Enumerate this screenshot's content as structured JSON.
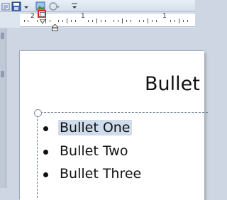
{
  "toolbar": {
    "icons": [
      "text-direction-icon",
      "save-icon",
      "picture-icon",
      "circle-icon",
      "dropdown-icon"
    ]
  },
  "ruler": {
    "numbers": [
      "2",
      "1",
      "1"
    ],
    "tab_selector": "left-tab-stop-icon"
  },
  "slide": {
    "title": "Bullet",
    "bullets": [
      {
        "text": "Bullet One",
        "selected": true
      },
      {
        "text": "Bullet Two",
        "selected": false
      },
      {
        "text": "Bullet Three",
        "selected": false
      }
    ]
  },
  "colors": {
    "highlight": "#e21a1a",
    "selection": "#cfdcec",
    "workspace": "#cdd6e2"
  }
}
